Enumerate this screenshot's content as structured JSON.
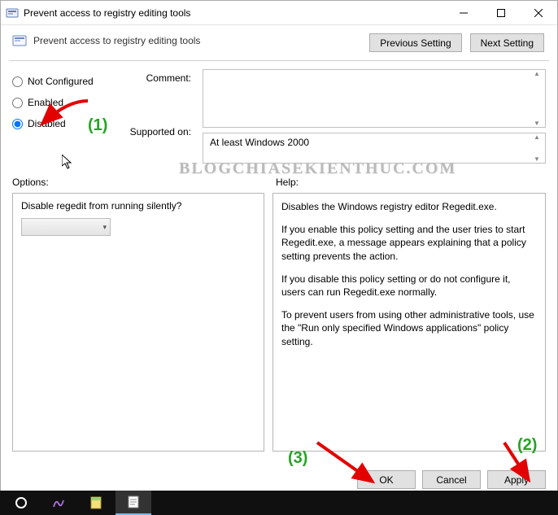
{
  "window": {
    "title": "Prevent access to registry editing tools",
    "subtitle": "Prevent access to registry editing tools"
  },
  "nav": {
    "previous": "Previous Setting",
    "next": "Next Setting"
  },
  "radios": {
    "not_configured": "Not Configured",
    "enabled": "Enabled",
    "disabled": "Disabled",
    "selected": "disabled"
  },
  "labels": {
    "comment": "Comment:",
    "supported": "Supported on:",
    "options": "Options:",
    "help": "Help:"
  },
  "supported_text": "At least Windows 2000",
  "options_panel": {
    "question": "Disable regedit from running silently?",
    "combo_value": ""
  },
  "help_panel": {
    "p1": "Disables the Windows registry editor Regedit.exe.",
    "p2": "If you enable this policy setting and the user tries to start Regedit.exe, a message appears explaining that a policy setting prevents the action.",
    "p3": "If you disable this policy setting or do not configure it, users can run Regedit.exe normally.",
    "p4": "To prevent users from using other administrative tools, use the \"Run only specified Windows applications\" policy setting."
  },
  "buttons": {
    "ok": "OK",
    "cancel": "Cancel",
    "apply": "Apply"
  },
  "annotations": {
    "n1": "(1)",
    "n2": "(2)",
    "n3": "(3)"
  },
  "watermark": "BLOGCHIASEKIENTHUC.COM",
  "icons": {
    "app": "policy-icon",
    "minimize": "minimize-icon",
    "maximize": "maximize-icon",
    "close": "close-icon",
    "cursor": "cursor-icon",
    "chevron": "chevron-down-icon"
  }
}
